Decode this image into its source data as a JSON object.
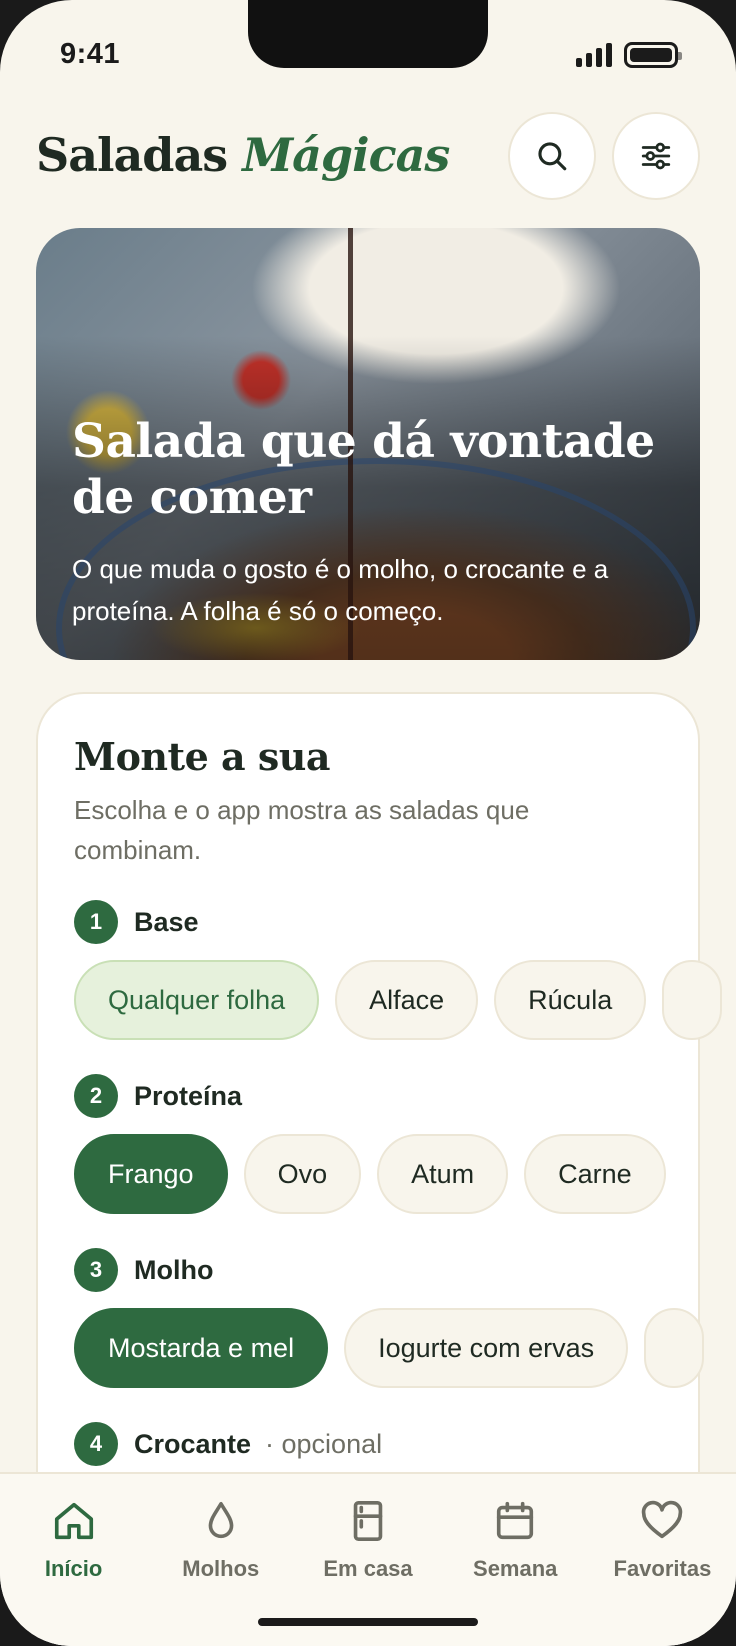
{
  "status": {
    "time": "9:41"
  },
  "header": {
    "title_main": "Saladas",
    "title_accent": "Mágicas",
    "search_icon": "search-icon",
    "filter_icon": "sliders-icon"
  },
  "hero": {
    "title": "Salada que dá vontade de comer",
    "subtitle": "O que muda o gosto é o molho, o crocante e a proteína. A folha é só o começo."
  },
  "builder": {
    "title": "Monte a sua",
    "subtitle": "Escolha e o app mostra as saladas que combinam.",
    "steps": [
      {
        "num": "1",
        "label": "Base",
        "chips": [
          "Qualquer folha",
          "Alface",
          "Rúcula"
        ],
        "selected": "Qualquer folha"
      },
      {
        "num": "2",
        "label": "Proteína",
        "chips": [
          "Frango",
          "Ovo",
          "Atum",
          "Carne"
        ],
        "selected": "Frango"
      },
      {
        "num": "3",
        "label": "Molho",
        "chips": [
          "Mostarda e mel",
          "Iogurte com ervas"
        ],
        "selected": "Mostarda e mel"
      },
      {
        "num": "4",
        "label": "Crocante",
        "optional": "· opcional"
      }
    ]
  },
  "tabs": [
    {
      "label": "Início",
      "icon": "home-icon",
      "active": true
    },
    {
      "label": "Molhos",
      "icon": "drop-icon"
    },
    {
      "label": "Em casa",
      "icon": "fridge-icon"
    },
    {
      "label": "Semana",
      "icon": "calendar-icon"
    },
    {
      "label": "Favoritas",
      "icon": "heart-icon"
    }
  ],
  "colors": {
    "accent": "#2e6a40",
    "background": "#f8f5ec",
    "soft_chip": "#e6f1dc"
  }
}
